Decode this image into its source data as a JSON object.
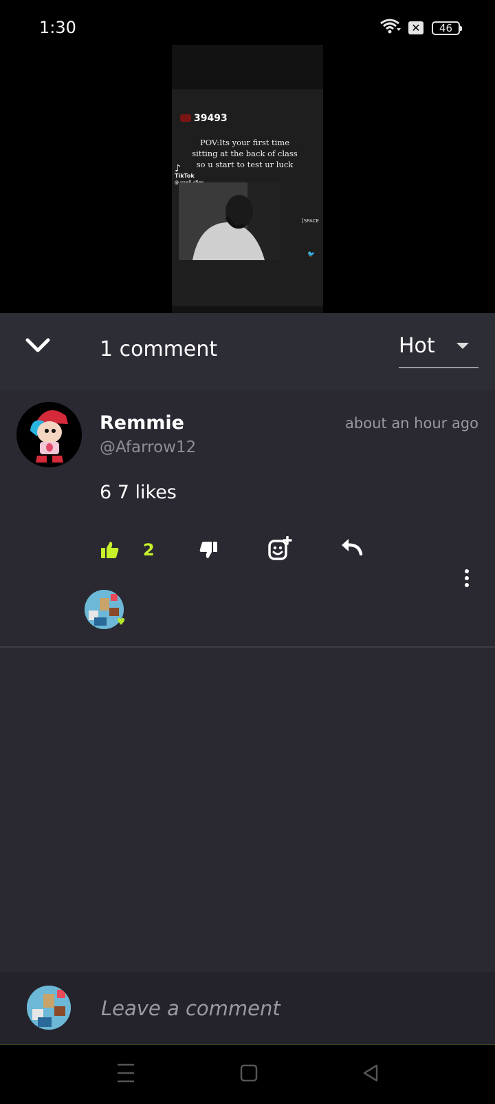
{
  "status_bar": {
    "time": "1:30",
    "battery": "46"
  },
  "video": {
    "view_count": "39493",
    "caption": "POV:Its your first time sitting at the back of class so u start to test ur luck",
    "tiktok_label": "TikTok",
    "tiktok_handle": "@ yagii.clips",
    "corner_text": "[SPACE"
  },
  "comments_header": {
    "count_label": "1 comment",
    "sort_value": "Hot"
  },
  "comment": {
    "author": "Remmie",
    "handle": "@Afarrow12",
    "time": "about an hour ago",
    "text": "6 7 likes",
    "like_count": "2"
  },
  "composer": {
    "placeholder": "Leave a comment"
  },
  "colors": {
    "accent": "#c6f12a",
    "sheet_bg": "#2a2932",
    "header_bg": "#2d2d35"
  }
}
